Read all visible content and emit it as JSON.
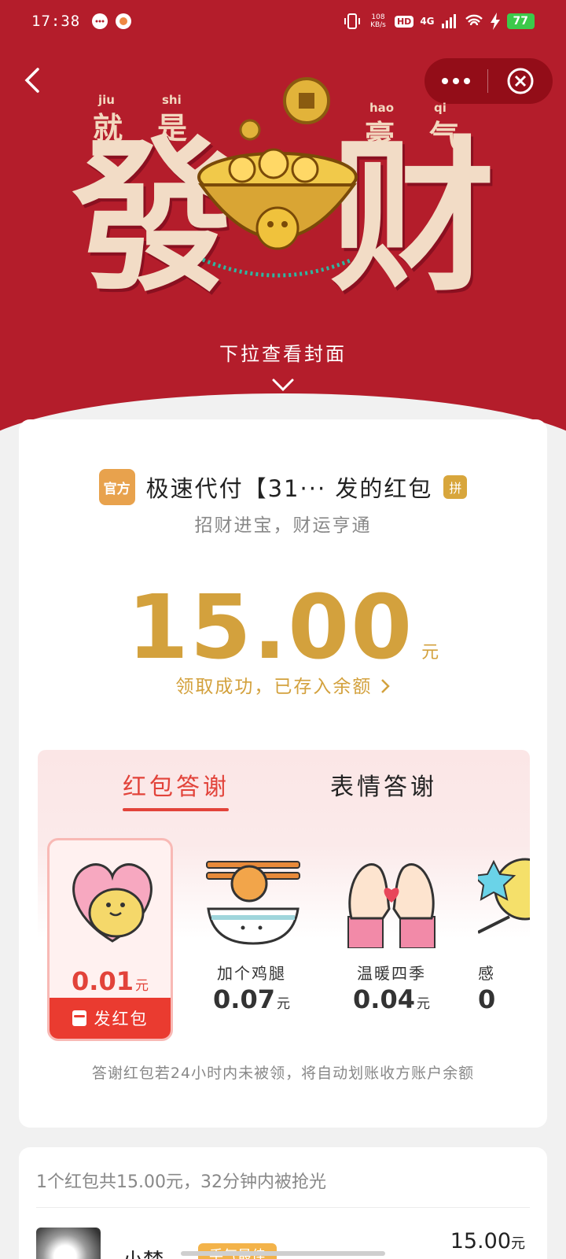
{
  "status_bar": {
    "time": "17:38",
    "net_speed": "108 KB/s",
    "hd": "HD",
    "signal": "4G",
    "battery": "77"
  },
  "cover": {
    "pinyin_1": "jiu",
    "pinyin_2": "shi",
    "pinyin_3": "hao",
    "pinyin_4": "qi",
    "small_1": "就",
    "small_2": "是",
    "small_3": "豪",
    "small_4": "气",
    "big_left": "發",
    "big_right": "财",
    "pull_hint": "下拉查看封面"
  },
  "packet": {
    "official_badge": "官方",
    "sender": "极速代付【31··· 发的红包",
    "pin_badge": "拼",
    "wish": "招财进宝，财运亨通",
    "amount": "15.00",
    "unit": "元",
    "success_text": "领取成功，已存入余额"
  },
  "thanks": {
    "tab_redpacket": "红包答谢",
    "tab_emoji": "表情答谢",
    "gifts": [
      {
        "name": "",
        "price": "0.01",
        "unit": "元",
        "icon": "heart-hug-icon"
      },
      {
        "name": "加个鸡腿",
        "price": "0.07",
        "unit": "元",
        "icon": "rice-bowl-drumstick-icon"
      },
      {
        "name": "温暖四季",
        "price": "0.04",
        "unit": "元",
        "icon": "heart-hands-icon"
      },
      {
        "name": "感",
        "price": "0",
        "unit": "",
        "icon": "star-wand-icon"
      }
    ],
    "send_button": "发红包",
    "note": "答谢红包若24小时内未被领，将自动划账收方账户余额"
  },
  "receivers": {
    "summary": "1个红包共15.00元，32分钟内被抢光",
    "items": [
      {
        "name": "小梦",
        "badge": "手气最佳",
        "amount": "15.00",
        "unit": "元"
      }
    ]
  },
  "colors": {
    "header_red": "#b41d2b",
    "gold": "#d3a13d",
    "accent_red": "#e2433a"
  }
}
